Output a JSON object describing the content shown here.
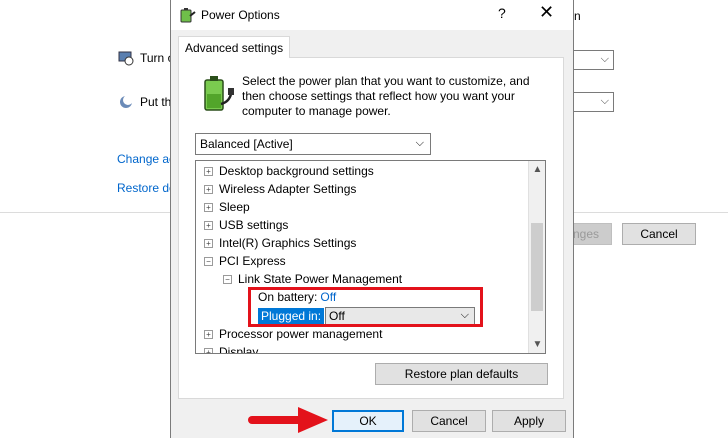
{
  "background": {
    "row1_label": "Turn o",
    "row2_label": "Put th",
    "link1": "Change ac",
    "link2": "Restore de",
    "right_letter": "n",
    "save_btn_partial": "nges",
    "cancel_label": "Cancel"
  },
  "dialog": {
    "title": "Power Options",
    "help": "?",
    "close": "✕",
    "tab_label": "Advanced settings",
    "description": "Select the power plan that you want to customize, and then choose settings that reflect how you want your computer to manage power.",
    "plan_selected": "Balanced [Active]",
    "tree": {
      "items": [
        {
          "label": "Desktop background settings",
          "expander": "+"
        },
        {
          "label": "Wireless Adapter Settings",
          "expander": "+"
        },
        {
          "label": "Sleep",
          "expander": "+"
        },
        {
          "label": "USB settings",
          "expander": "+"
        },
        {
          "label": "Intel(R) Graphics Settings",
          "expander": "+"
        },
        {
          "label": "PCI Express",
          "expander": "−"
        }
      ],
      "sub_item": {
        "label": "Link State Power Management",
        "expander": "−"
      },
      "on_battery_label": "On battery:",
      "on_battery_value": "Off",
      "plugged_in_label": "Plugged in:",
      "plugged_in_value": "Off",
      "after_items": [
        {
          "label": "Processor power management",
          "expander": "+"
        },
        {
          "label": "Display",
          "expander": "+"
        }
      ]
    },
    "restore_defaults_label": "Restore plan defaults",
    "ok_label": "OK",
    "cancel_label": "Cancel",
    "apply_label": "Apply"
  },
  "colors": {
    "accent": "#0078d7",
    "highlight_box": "#e3121b",
    "link": "#0066cc"
  }
}
